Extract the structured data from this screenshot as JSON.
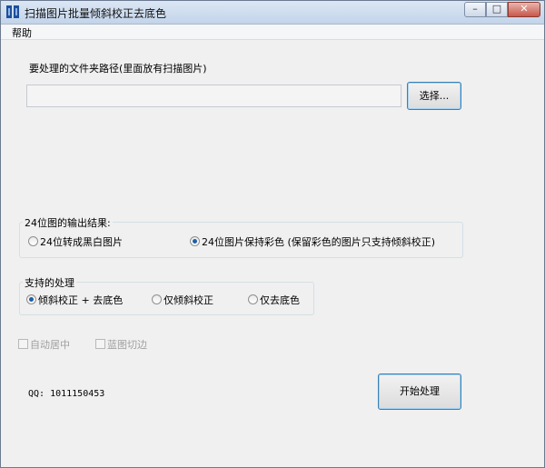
{
  "window": {
    "title": "扫描图片批量倾斜校正去底色",
    "minimize_symbol": "–",
    "maximize_symbol": "□",
    "close_symbol": "✕"
  },
  "menu": {
    "items": [
      {
        "label": "帮助"
      }
    ]
  },
  "folder": {
    "label": "要处理的文件夹路径(里面放有扫描图片)",
    "path_value": "",
    "browse_button": "选择..."
  },
  "output_24bit": {
    "group_label": "24位图的输出结果:",
    "options": [
      {
        "label": "24位转成黑白图片",
        "checked": false
      },
      {
        "label": "24位图片保持彩色 (保留彩色的图片只支持倾斜校正)",
        "checked": true
      }
    ]
  },
  "processing": {
    "group_label": "支持的处理",
    "options": [
      {
        "label": "倾斜校正 + 去底色",
        "checked": true
      },
      {
        "label": "仅倾斜校正",
        "checked": false
      },
      {
        "label": "仅去底色",
        "checked": false
      }
    ]
  },
  "extras": {
    "auto_center": {
      "label": "自动居中",
      "checked": false,
      "enabled": false
    },
    "blue_trim": {
      "label": "蓝图切边",
      "checked": false,
      "enabled": false
    }
  },
  "footer": {
    "qq_text": "QQ: 1011150453",
    "start_button": "开始处理"
  },
  "icons": {
    "app": "app-logo-icon"
  },
  "colors": {
    "titlebar": "#c3d4ea",
    "radio_dot": "#1f5fa8",
    "button_focus": "#3c7fb1"
  }
}
